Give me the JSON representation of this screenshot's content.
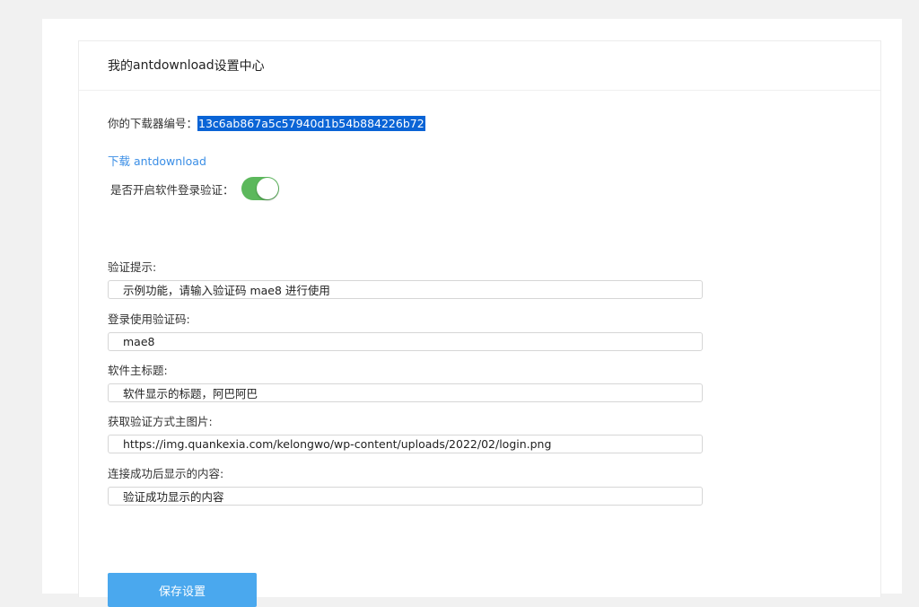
{
  "header": {
    "title_prefix": "我的 ",
    "brand": "antdownload",
    "title_suffix": " 设置中心"
  },
  "downloader": {
    "id_label": "你的下载器编号：",
    "id_value": "13c6ab867a5c57940d1b54b884226b72"
  },
  "download_link": "下载 antdownload",
  "login_verify": {
    "label": "是否开启软件登录验证：",
    "enabled": true,
    "color": "#5cb85c"
  },
  "fields": [
    {
      "label": "验证提示:",
      "value": "示例功能，请输入验证码 mae8 进行使用"
    },
    {
      "label": "登录使用验证码:",
      "value": "mae8"
    },
    {
      "label": "软件主标题:",
      "value": "软件显示的标题，阿巴阿巴"
    },
    {
      "label": "获取验证方式主图片:",
      "value": "https://img.quankexia.com/kelongwo/wp-content/uploads/2022/02/login.png"
    },
    {
      "label": "连接成功后显示的内容:",
      "value": "验证成功显示的内容"
    }
  ],
  "save_button": {
    "label": "保存设置",
    "color": "#4aa8ee"
  }
}
